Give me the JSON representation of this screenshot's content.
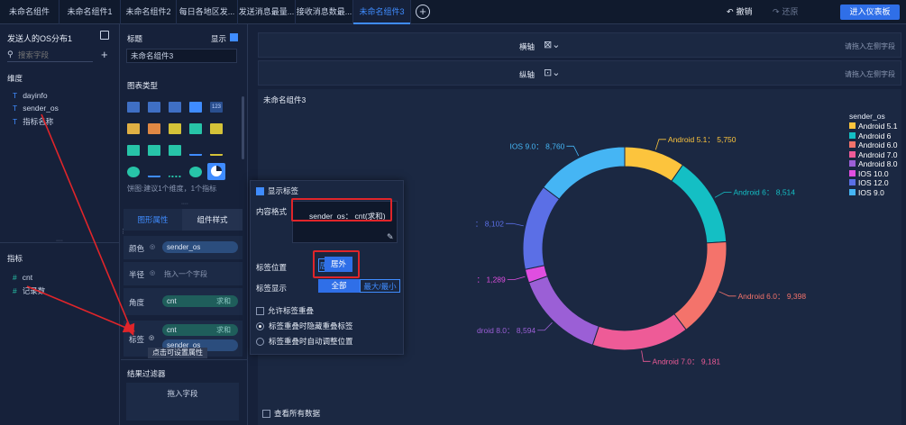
{
  "tabs": [
    {
      "label": "未命名组件",
      "active": false
    },
    {
      "label": "未命名组件1",
      "active": false
    },
    {
      "label": "未命名组件2",
      "active": false
    },
    {
      "label": "每日各地区发...",
      "active": false
    },
    {
      "label": "发送消息最量...",
      "active": false
    },
    {
      "label": "接收消息数最...",
      "active": false
    },
    {
      "label": "未命名组件3",
      "active": true
    }
  ],
  "toolbar": {
    "undo": "撤销",
    "redo": "还原",
    "enter_dashboard": "进入仪表板"
  },
  "field_panel": {
    "dataset": "发送人的OS分布1",
    "search_placeholder": "搜索字段",
    "dimension_title": "维度",
    "dimensions": [
      "dayinfo",
      "sender_os",
      "指标名称"
    ],
    "measure_title": "指标",
    "measures": [
      "cnt",
      "记录数"
    ]
  },
  "config": {
    "title_label": "标题",
    "show_label": "显示",
    "title_value": "未命名组件3",
    "chart_type_label": "图表类型",
    "chart_type_hint": "饼图:建议1个维度，1个指标",
    "tab_graphic": "图形属性",
    "tab_component": "组件样式",
    "rows": {
      "color": {
        "label": "颜色",
        "value": "sender_os"
      },
      "radius": {
        "label": "半径",
        "value": "拖入一个字段"
      },
      "angle": {
        "label": "角度",
        "value": "cnt",
        "agg": "求和"
      },
      "label": {
        "label": "标签",
        "value1": "cnt",
        "agg": "求和",
        "value2": "sender_os"
      }
    },
    "tooltip": "点击可设置属性",
    "filter_label": "结果过滤器",
    "filter_drop": "拖入字段"
  },
  "popup": {
    "show_label": "显示标签",
    "content_format_label": "内容格式",
    "content_format_value": "sender_os： cnt(求和)",
    "label_position_label": "标签位置",
    "pos_inside": "居内",
    "pos_outside": "居外",
    "label_display_label": "标签显示",
    "display_all": "全部",
    "display_minmax": "最大/最小",
    "allow_overlap": "允许标签重叠",
    "overlap_hide": "标签重叠时隐藏重叠标签",
    "overlap_adjust": "标签重叠时自动调整位置"
  },
  "axes": {
    "x_label": "横轴",
    "y_label": "纵轴",
    "drop_hint": "请拖入左侧字段"
  },
  "chart_title": "未命名组件3",
  "view_all_data": "查看所有数据",
  "chart_data": {
    "type": "pie",
    "donut": true,
    "legend_title": "sender_os",
    "legend_position": "right",
    "slices": [
      {
        "name": "Android 5.1",
        "value": 5750,
        "color": "#fcc43d",
        "label": "Android 5.1： 5,750"
      },
      {
        "name": "Android 6",
        "value": 8514,
        "color": "#14bfc4",
        "label": "Android 6： 8,514"
      },
      {
        "name": "Android 6.0",
        "value": 9398,
        "color": "#f4736b",
        "label": "Android 6.0： 9,398"
      },
      {
        "name": "Android 7.0",
        "value": 9181,
        "color": "#ee5b97",
        "label": "Android 7.0： 9,181"
      },
      {
        "name": "Android 8.0",
        "value": 8594,
        "color": "#9b5fd6",
        "label": "droid 8.0： 8,594"
      },
      {
        "name": "IOS 10.0",
        "value": 1289,
        "color": "#e04ee0",
        "label": "： 1,289"
      },
      {
        "name": "IOS 12.0",
        "value": 8102,
        "color": "#5b6fe6",
        "label": "： 8,102"
      },
      {
        "name": "IOS 9.0",
        "value": 8760,
        "color": "#45b5f4",
        "label": "IOS 9.0： 8,760"
      }
    ]
  }
}
